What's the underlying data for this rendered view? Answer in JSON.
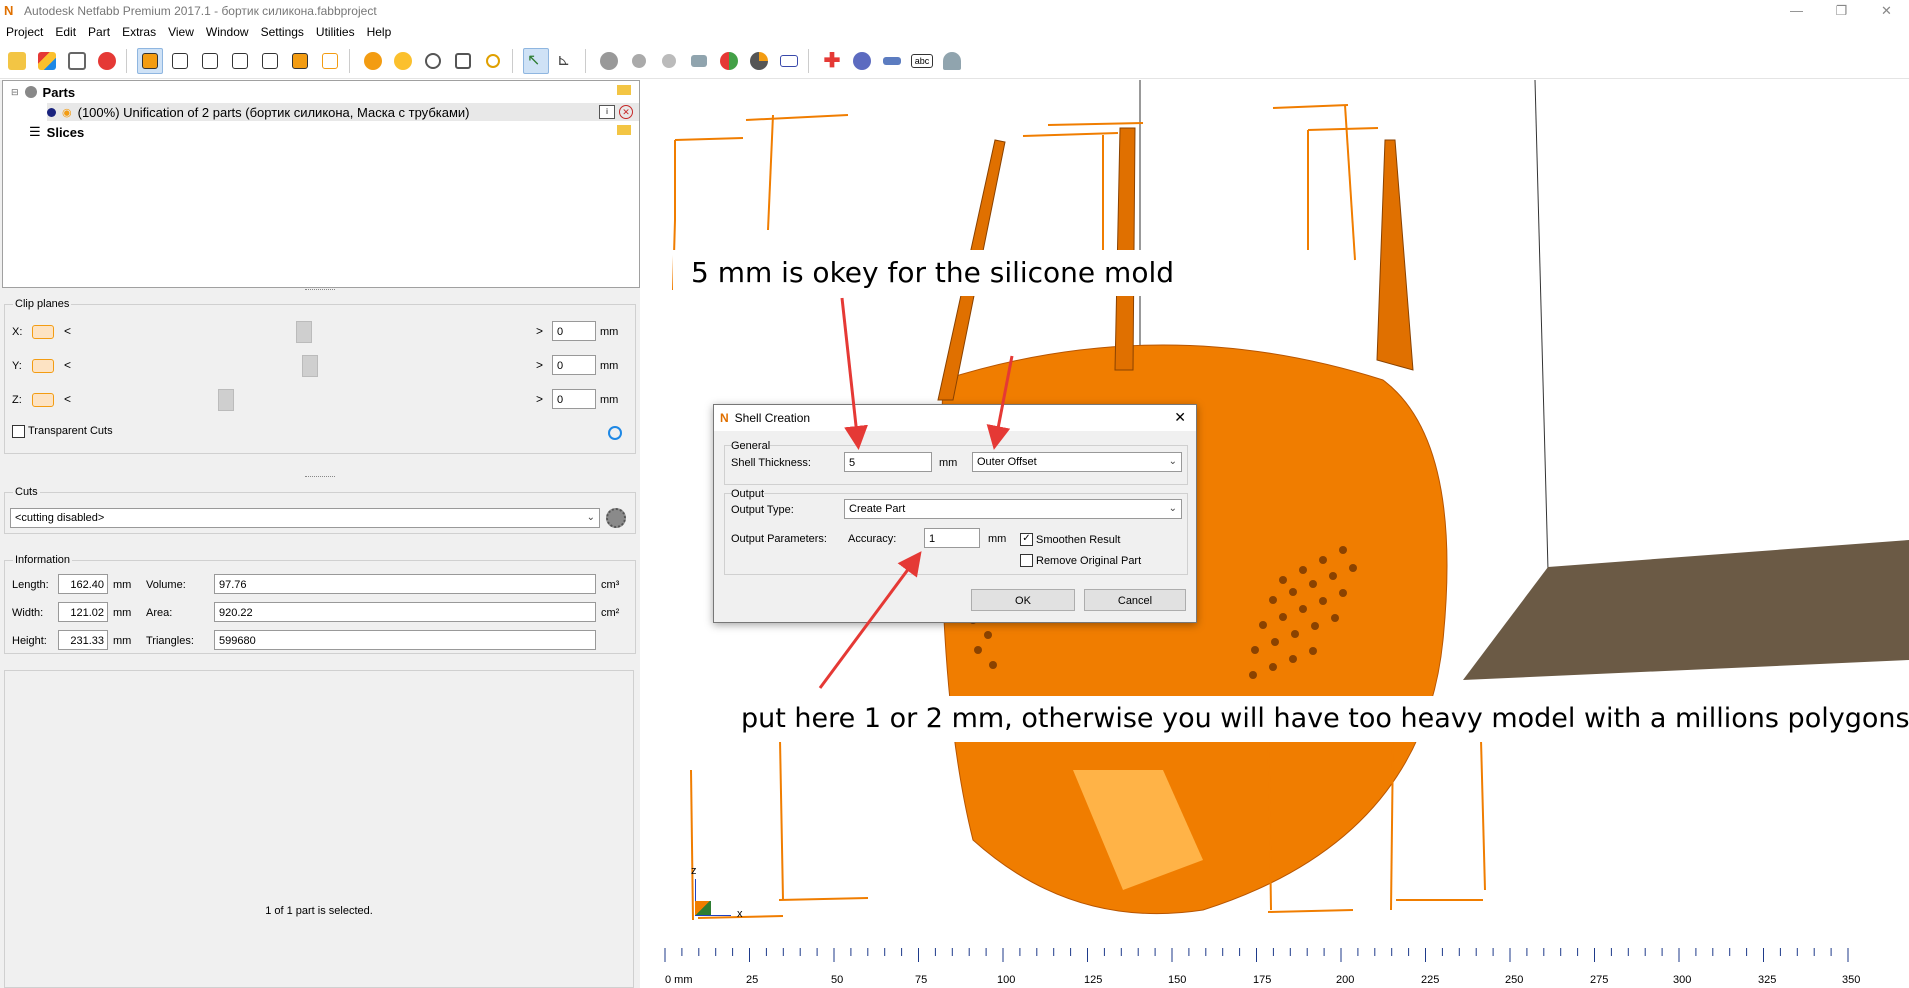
{
  "window": {
    "title": "Autodesk Netfabb Premium 2017.1 - бортик силикона.fabbproject"
  },
  "menu": [
    "Project",
    "Edit",
    "Part",
    "Extras",
    "View",
    "Window",
    "Settings",
    "Utilities",
    "Help"
  ],
  "tree": {
    "parts_label": "Parts",
    "part_item": "(100%) Unification of 2 parts (бортик силикона, Маска с трубками)",
    "slices_label": "Slices"
  },
  "clip_planes": {
    "title": "Clip planes",
    "x_label": "X:",
    "y_label": "Y:",
    "z_label": "Z:",
    "x_value": "0",
    "y_value": "0",
    "z_value": "0",
    "unit": "mm",
    "transparent_cuts": "Transparent Cuts"
  },
  "cuts": {
    "title": "Cuts",
    "selected": "<cutting disabled>"
  },
  "information": {
    "title": "Information",
    "length_label": "Length:",
    "length": "162.40",
    "width_label": "Width:",
    "width": "121.02",
    "height_label": "Height:",
    "height": "231.33",
    "unit_mm": "mm",
    "volume_label": "Volume:",
    "volume": "97.76",
    "volume_unit": "cm³",
    "area_label": "Area:",
    "area": "920.22",
    "area_unit": "cm²",
    "triangles_label": "Triangles:",
    "triangles": "599680"
  },
  "status": "1 of 1 part is selected.",
  "dialog": {
    "title": "Shell Creation",
    "general_label": "General",
    "shell_thickness_label": "Shell Thickness:",
    "shell_thickness_value": "5",
    "mm": "mm",
    "offset_type": "Outer Offset",
    "output_label": "Output",
    "output_type_label": "Output Type:",
    "output_type": "Create Part",
    "output_params_label": "Output Parameters:",
    "accuracy_label": "Accuracy:",
    "accuracy_value": "1",
    "smoothen": "Smoothen Result",
    "smoothen_checked": true,
    "remove_original": "Remove Original Part",
    "ok": "OK",
    "cancel": "Cancel"
  },
  "callouts": {
    "top": "5 mm is okey for the silicone mold",
    "bottom": "put here 1 or 2 mm, otherwise you will have too heavy model with a millions polygons"
  },
  "ruler": {
    "labels": [
      "0 mm",
      "25",
      "50",
      "75",
      "100",
      "125",
      "150",
      "175",
      "200",
      "225",
      "250",
      "275",
      "300",
      "325",
      "350"
    ]
  },
  "axes": {
    "z": "z",
    "x": "x"
  },
  "colors": {
    "model": "#f07d00",
    "model_dark": "#b85500",
    "arrow": "#e53935",
    "bed": "#6b5a45"
  }
}
